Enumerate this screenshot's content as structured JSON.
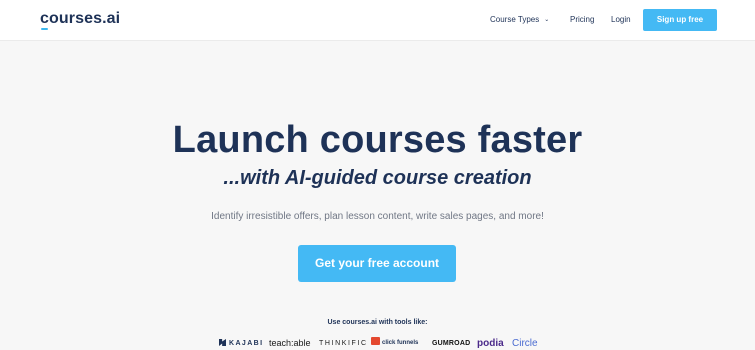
{
  "header": {
    "logo_text_c": "c",
    "logo_text_rest": "ourses",
    "logo_text_suffix": ".ai",
    "nav": [
      {
        "label": "Course Types",
        "icon": "chevron-down-icon"
      },
      {
        "label": "Pricing"
      },
      {
        "label": "Login"
      }
    ],
    "signup_label": "Sign up free"
  },
  "hero": {
    "headline": "Launch courses faster",
    "subheadline": "...with AI-guided course creation",
    "description": "Identify irresistible offers, plan lesson content, write sales pages, and more!",
    "cta_label": "Get your free account"
  },
  "tools": {
    "caption": "Use courses.ai with tools like:",
    "logos": [
      "KAJABI",
      "teach:able",
      "THINKIFIC",
      "click funnels",
      "GUMROAD",
      "podia",
      "Circle"
    ]
  },
  "colors": {
    "brand_navy": "#1e3257",
    "accent_blue": "#44b9f4",
    "background": "#f7f7f7"
  }
}
